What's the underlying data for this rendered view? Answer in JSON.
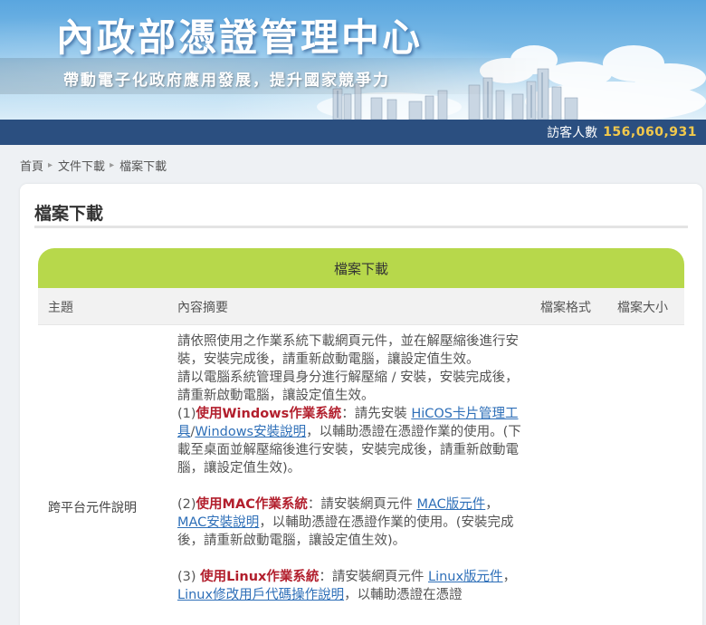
{
  "header": {
    "site_title": "內政部憑證管理中心",
    "slogan": "帶動電子化政府應用發展，提升國家競爭力"
  },
  "visitor": {
    "label": "訪客人數",
    "count": "156,060,931"
  },
  "breadcrumb": [
    "首頁",
    "文件下載",
    "檔案下載"
  ],
  "page": {
    "title": "檔案下載",
    "table_caption": "檔案下載",
    "columns": [
      "主題",
      "內容摘要",
      "檔案格式",
      "檔案大小"
    ]
  },
  "row": {
    "topic": "跨平台元件說明",
    "intro1": "請依照使用之作業系統下載網頁元件，並在解壓縮後進行安裝，安裝完成後，請重新啟動電腦，讓設定值生效。",
    "intro2": "請以電腦系統管理員身分進行解壓縮 / 安裝，安裝完成後，請重新啟動電腦，讓設定值生效。",
    "win_prefix": "(1)",
    "win_heading": "使用Windows作業系統",
    "win_text1": "：請先安裝 ",
    "win_link1": "HiCOS卡片管理工具",
    "win_slash": "/",
    "win_link2": "Windows安裝說明",
    "win_text2": "，以輔助憑證在憑證作業的使用。(下載至桌面並解壓縮後進行安裝，安裝完成後，請重新啟動電腦，讓設定值生效)。",
    "mac_prefix": "(2)",
    "mac_heading": "使用MAC作業系統",
    "mac_text1": "：請安裝網頁元件 ",
    "mac_link1": "MAC版元件",
    "mac_text2": "，",
    "mac_link2": "MAC安裝說明",
    "mac_text3": "，以輔助憑證在憑證作業的使用。(安裝完成後，請重新啟動電腦，讓設定值生效)。",
    "linux_prefix": "(3) ",
    "linux_heading": "使用Linux作業系統",
    "linux_text1": "：請安裝網頁元件 ",
    "linux_link1": "Linux版元件",
    "linux_text2": "，",
    "linux_link2": "Linux修改用戶代碼操作說明",
    "linux_text3": "，以輔助憑證在憑證"
  }
}
